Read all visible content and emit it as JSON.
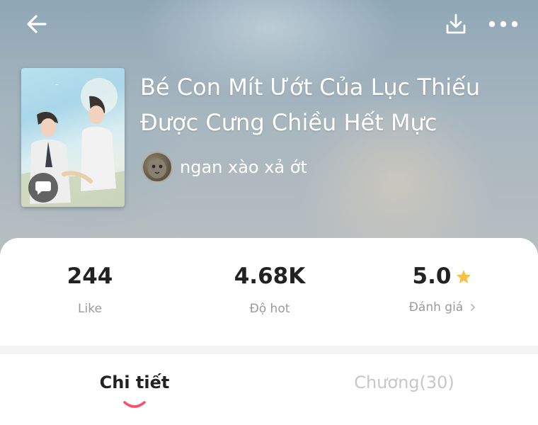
{
  "header": {
    "back_icon": "arrow-left-icon",
    "download_icon": "download-icon",
    "more_icon": "more-horizontal-icon"
  },
  "book": {
    "title": "Bé Con Mít Ướt Của Lục Thiếu Được Cưng Chiều Hết Mực",
    "author": "ngan xào xả ớt"
  },
  "stats": {
    "likes": {
      "value": "244",
      "label": "Like"
    },
    "hot": {
      "value": "4.68K",
      "label": "Độ hot"
    },
    "rating": {
      "value": "5.0",
      "label": "Đánh giá",
      "star_color": "#f6c244"
    }
  },
  "tabs": {
    "details": "Chi tiết",
    "chapters": "Chương(30)",
    "active_color": "#ff4d6d"
  }
}
